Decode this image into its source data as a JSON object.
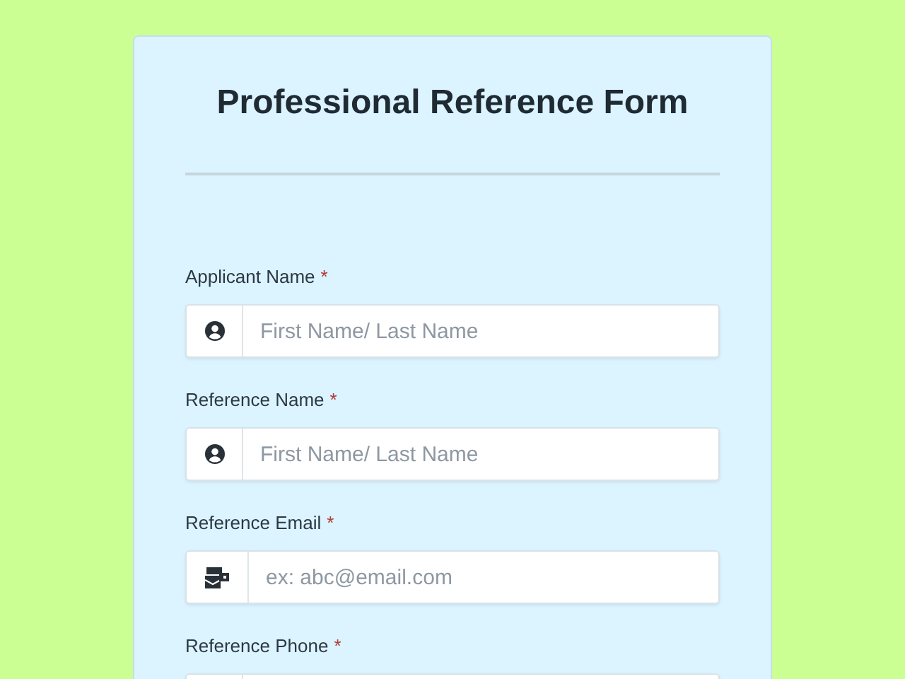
{
  "form": {
    "title": "Professional Reference Form",
    "fields": [
      {
        "label": "Applicant Name",
        "required_mark": "*",
        "kind": "person",
        "placeholder": "First Name/ Last Name"
      },
      {
        "label": "Reference Name",
        "required_mark": "*",
        "kind": "person",
        "placeholder": "First Name/ Last Name"
      },
      {
        "label": "Reference Email",
        "required_mark": "*",
        "kind": "mail",
        "placeholder": "ex: abc@email.com"
      },
      {
        "label": "Reference Phone",
        "required_mark": "*"
      }
    ]
  }
}
